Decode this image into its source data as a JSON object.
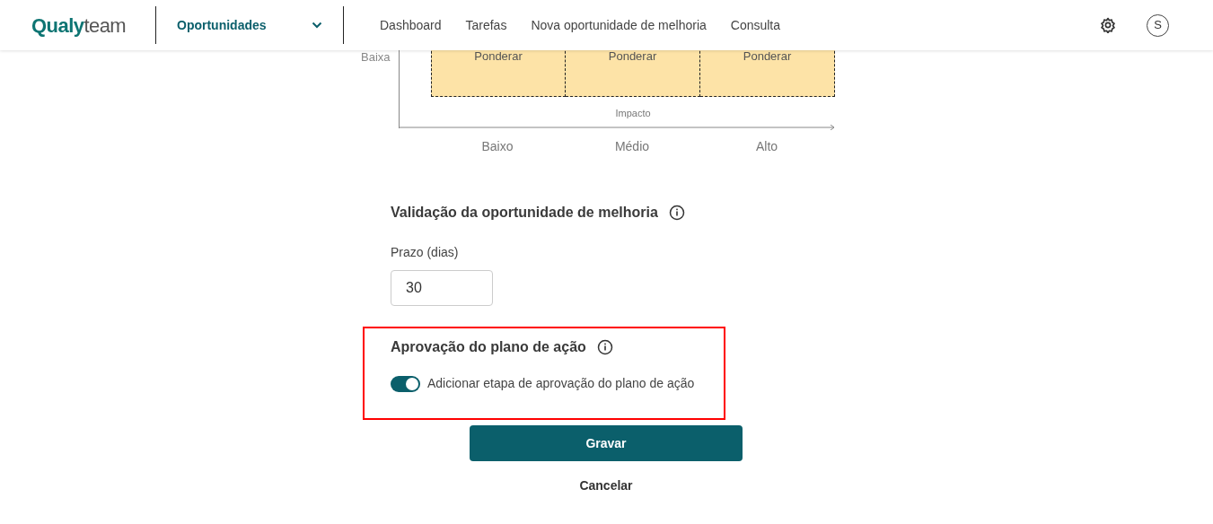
{
  "header": {
    "logo": {
      "part_1": "Qualy",
      "part_2": "team"
    },
    "module": "Oportunidades",
    "nav": [
      {
        "label": "Dashboard"
      },
      {
        "label": "Tarefas"
      },
      {
        "label": "Nova oportunidade de melhoria"
      },
      {
        "label": "Consulta"
      }
    ],
    "avatar": "S"
  },
  "matrix": {
    "row_label": "Baixa",
    "cells": [
      "Ponderar",
      "Ponderar",
      "Ponderar"
    ],
    "axis_title": "Impacto",
    "columns": [
      "Baixo",
      "Médio",
      "Alto"
    ]
  },
  "validation": {
    "title": "Validação da oportunidade de melhoria",
    "field_label": "Prazo (dias)",
    "value": "30"
  },
  "approval": {
    "title": "Aprovação do plano de ação",
    "toggle": {
      "label": "Adicionar etapa de aprovação do plano de ação",
      "on": true
    }
  },
  "buttons": {
    "save": "Gravar",
    "cancel": "Cancelar"
  }
}
